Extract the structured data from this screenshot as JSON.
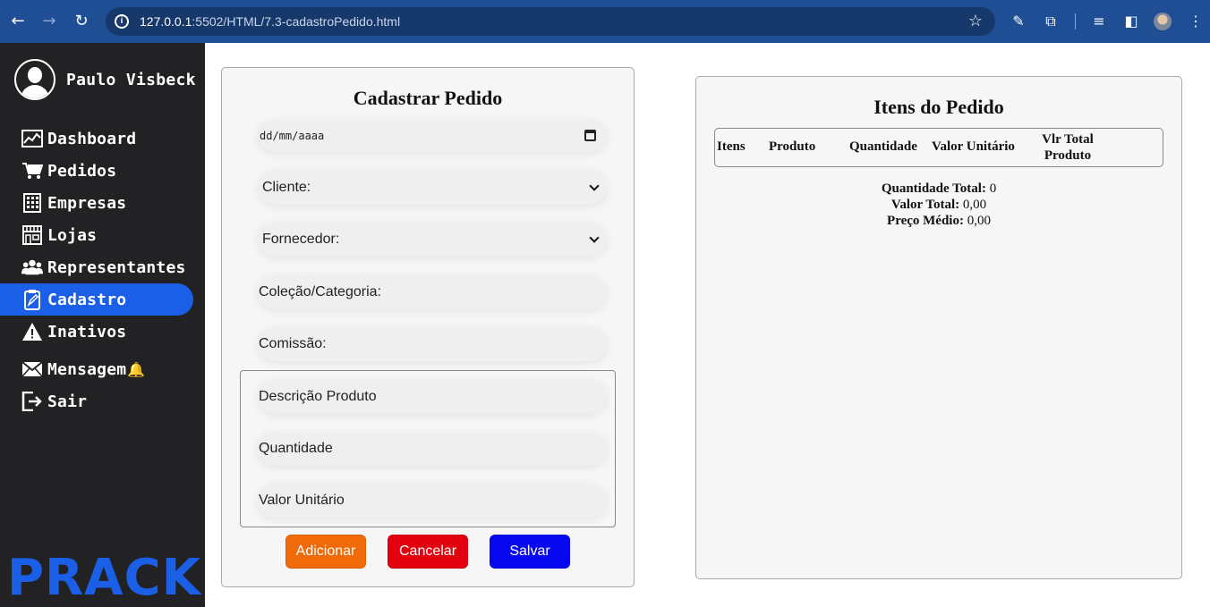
{
  "browser": {
    "url_host": "127.0.0.1",
    "url_rest": ":5502/HTML/7.3-cadastroPedido.html"
  },
  "sidebar": {
    "user_name": "Paulo Visbeck",
    "items": [
      {
        "label": "Dashboard",
        "icon": "chart-line-icon"
      },
      {
        "label": "Pedidos",
        "icon": "shopping-cart-icon"
      },
      {
        "label": "Empresas",
        "icon": "building-icon"
      },
      {
        "label": "Lojas",
        "icon": "store-icon"
      },
      {
        "label": "Representantes",
        "icon": "users-icon"
      },
      {
        "label": "Cadastro",
        "icon": "clipboard-icon",
        "active": true
      },
      {
        "label": "Inativos",
        "icon": "warning-icon"
      },
      {
        "label": "Mensagem",
        "icon": "envelope-icon"
      },
      {
        "label": "Sair",
        "icon": "sign-out-icon"
      }
    ],
    "message_badge": "🔔",
    "brand": "PRACK"
  },
  "form": {
    "title": "Cadastrar Pedido",
    "date_placeholder": "dd/mm/aaaa",
    "cliente_select": "Cliente:",
    "fornecedor_select": "Fornecedor:",
    "colecao_placeholder": "Coleção/Categoria:",
    "comissao_placeholder": "Comissão:",
    "descricao_placeholder": "Descrição Produto",
    "quantidade_placeholder": "Quantidade",
    "valor_placeholder": "Valor Unitário",
    "add_label": "Adicionar",
    "cancel_label": "Cancelar",
    "save_label": "Salvar"
  },
  "items": {
    "title": "Itens do Pedido",
    "columns": [
      "Itens",
      "Produto",
      "Quantidade",
      "Valor Unitário",
      "Vlr Total Produto"
    ],
    "qty_total_label": "Quantidade Total:",
    "qty_total_value": "0",
    "value_total_label": "Valor Total:",
    "value_total_value": "0,00",
    "avg_price_label": "Preço Médio:",
    "avg_price_value": "0,00"
  },
  "colors": {
    "chrome": "#1f4e94",
    "sidebar": "#222224",
    "accent": "#1a5fe6",
    "add": "#f06a0a",
    "cancel": "#e3000f",
    "save": "#0707f0"
  }
}
